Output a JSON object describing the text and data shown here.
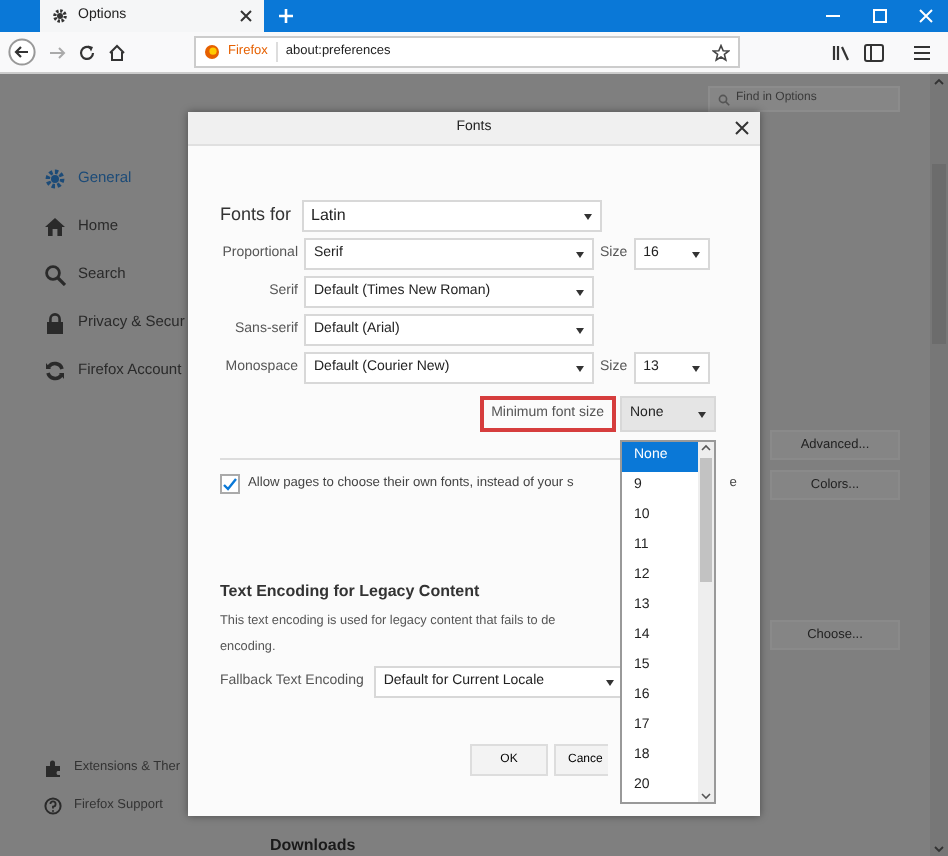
{
  "tabs": [
    {
      "label": "Options",
      "selected": true
    }
  ],
  "address_bar": {
    "identity": "Firefox",
    "url": "about:preferences"
  },
  "search": {
    "placeholder": "Find in Options"
  },
  "sidebar": {
    "items": [
      {
        "label": "General",
        "selected": true
      },
      {
        "label": "Home",
        "selected": false
      },
      {
        "label": "Search",
        "selected": false
      },
      {
        "label": "Privacy & Secur",
        "selected": false
      },
      {
        "label": "Firefox Account",
        "selected": false
      }
    ],
    "footer": [
      "Extensions & Ther",
      "Firefox Support"
    ]
  },
  "page": {
    "buttons": [
      "Advanced...",
      "Colors...",
      "Choose..."
    ],
    "heading": "Downloads"
  },
  "dialog": {
    "title": "Fonts",
    "fonts_for": {
      "label": "Fonts for",
      "value": "Latin"
    },
    "rows": [
      {
        "label": "Proportional",
        "value": "Serif",
        "size_label": "Size",
        "size": "16"
      },
      {
        "label": "Serif",
        "value": "Default (Times New Roman)"
      },
      {
        "label": "Sans-serif",
        "value": "Default (Arial)"
      },
      {
        "label": "Monospace",
        "value": "Default (Courier New)",
        "size_label": "Size",
        "size": "13"
      }
    ],
    "minimum": {
      "label": "Minimum font size",
      "value": "None",
      "highlighted": true
    },
    "allow": {
      "label": "Allow pages to choose their own fonts, instead of your s",
      "tail": "e",
      "checked": true
    },
    "encoding": {
      "heading": "Text Encoding for Legacy Content",
      "lines": [
        "This text encoding is used for legacy content that fails to de",
        "encoding."
      ],
      "fallback_label": "Fallback Text Encoding",
      "fallback_value": "Default for Current Locale"
    },
    "buttons": [
      "OK",
      "Cance"
    ],
    "dropdown": [
      {
        "label": "None",
        "selected": true
      },
      {
        "label": "9",
        "selected": false
      },
      {
        "label": "10",
        "selected": false
      },
      {
        "label": "11",
        "selected": false
      },
      {
        "label": "12",
        "selected": false
      },
      {
        "label": "13",
        "selected": false
      },
      {
        "label": "14",
        "selected": false
      },
      {
        "label": "15",
        "selected": false
      },
      {
        "label": "16",
        "selected": false
      },
      {
        "label": "17",
        "selected": false
      },
      {
        "label": "18",
        "selected": false
      },
      {
        "label": "20",
        "selected": false
      }
    ]
  }
}
